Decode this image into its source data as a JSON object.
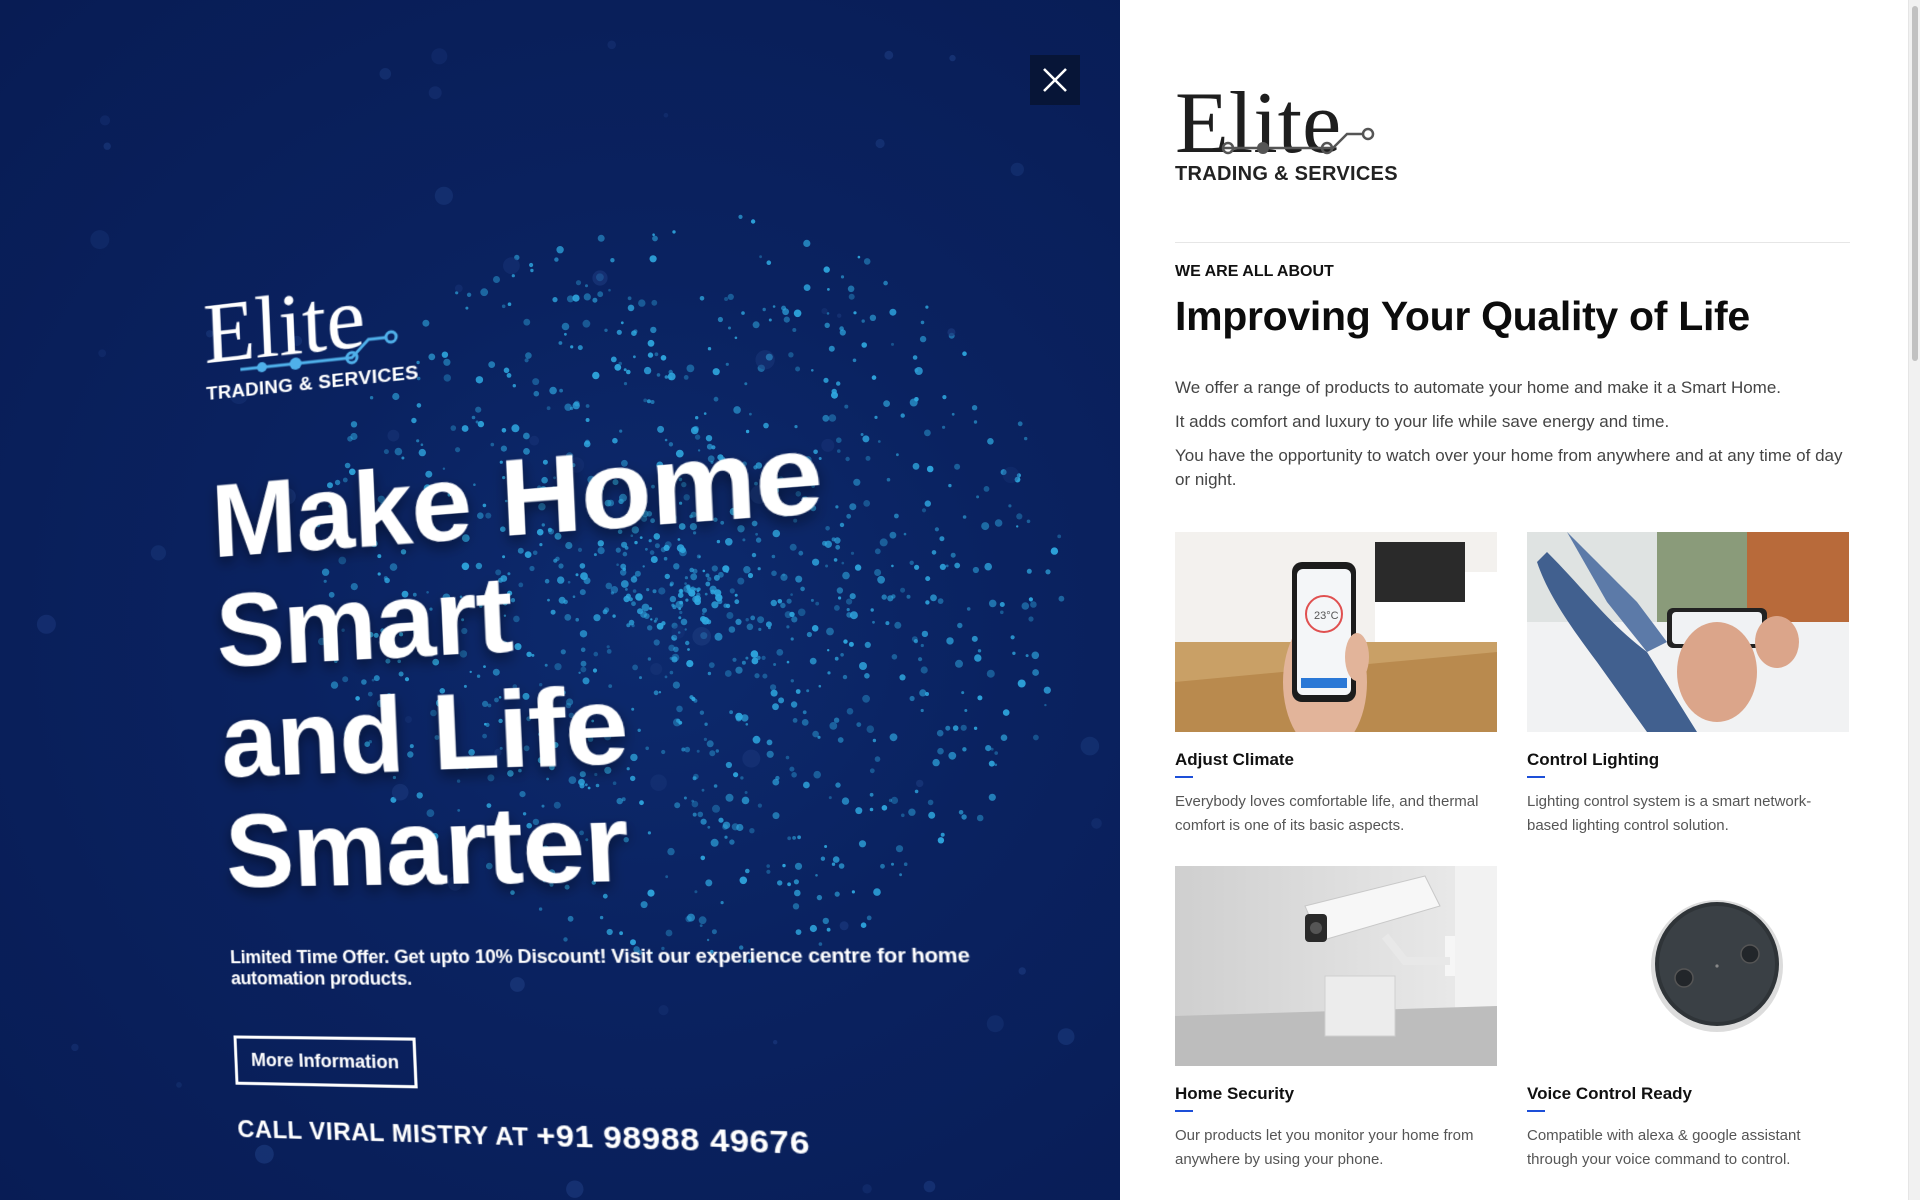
{
  "hero": {
    "logo_word": "Elite",
    "logo_sub": "TRADING & SERVICES",
    "title_line1": "Make Home Smart",
    "title_line2": "and Life Smarter",
    "offer": "Limited Time Offer. Get upto 10% Discount! Visit our experience centre for home automation products.",
    "button_label": "More Information",
    "call_prefix": "CALL VIRAL MISTRY AT",
    "call_phone": "+91 98988 49676",
    "close_icon": "close-icon",
    "colors": {
      "background": "#0a2260",
      "particles": "#2fa8e0"
    }
  },
  "panel": {
    "brand_word": "Elite",
    "brand_sub": "TRADING & SERVICES",
    "eyebrow": "WE ARE ALL ABOUT",
    "headline": "Improving Your Quality of Life",
    "intro": [
      "We offer a range of products to automate your home and make it a Smart Home.",
      "It adds comfort and luxury to your life while save energy and time.",
      "You have the opportunity to watch over your home from anywhere and at any time of day or night."
    ],
    "features": [
      {
        "title": "Adjust Climate",
        "desc": "Everybody loves comfortable life, and thermal comfort is one of its basic aspects.",
        "screen_text": "23°C"
      },
      {
        "title": "Control Lighting",
        "desc": "Lighting control system is a smart network-based lighting control solution."
      },
      {
        "title": "Home Security",
        "desc": "Our products let you monitor your home from anywhere by using your phone."
      },
      {
        "title": "Voice Control Ready",
        "desc": "Compatible with alexa & google assistant through your voice command to control."
      }
    ],
    "accent_color": "#1d4fd8"
  }
}
